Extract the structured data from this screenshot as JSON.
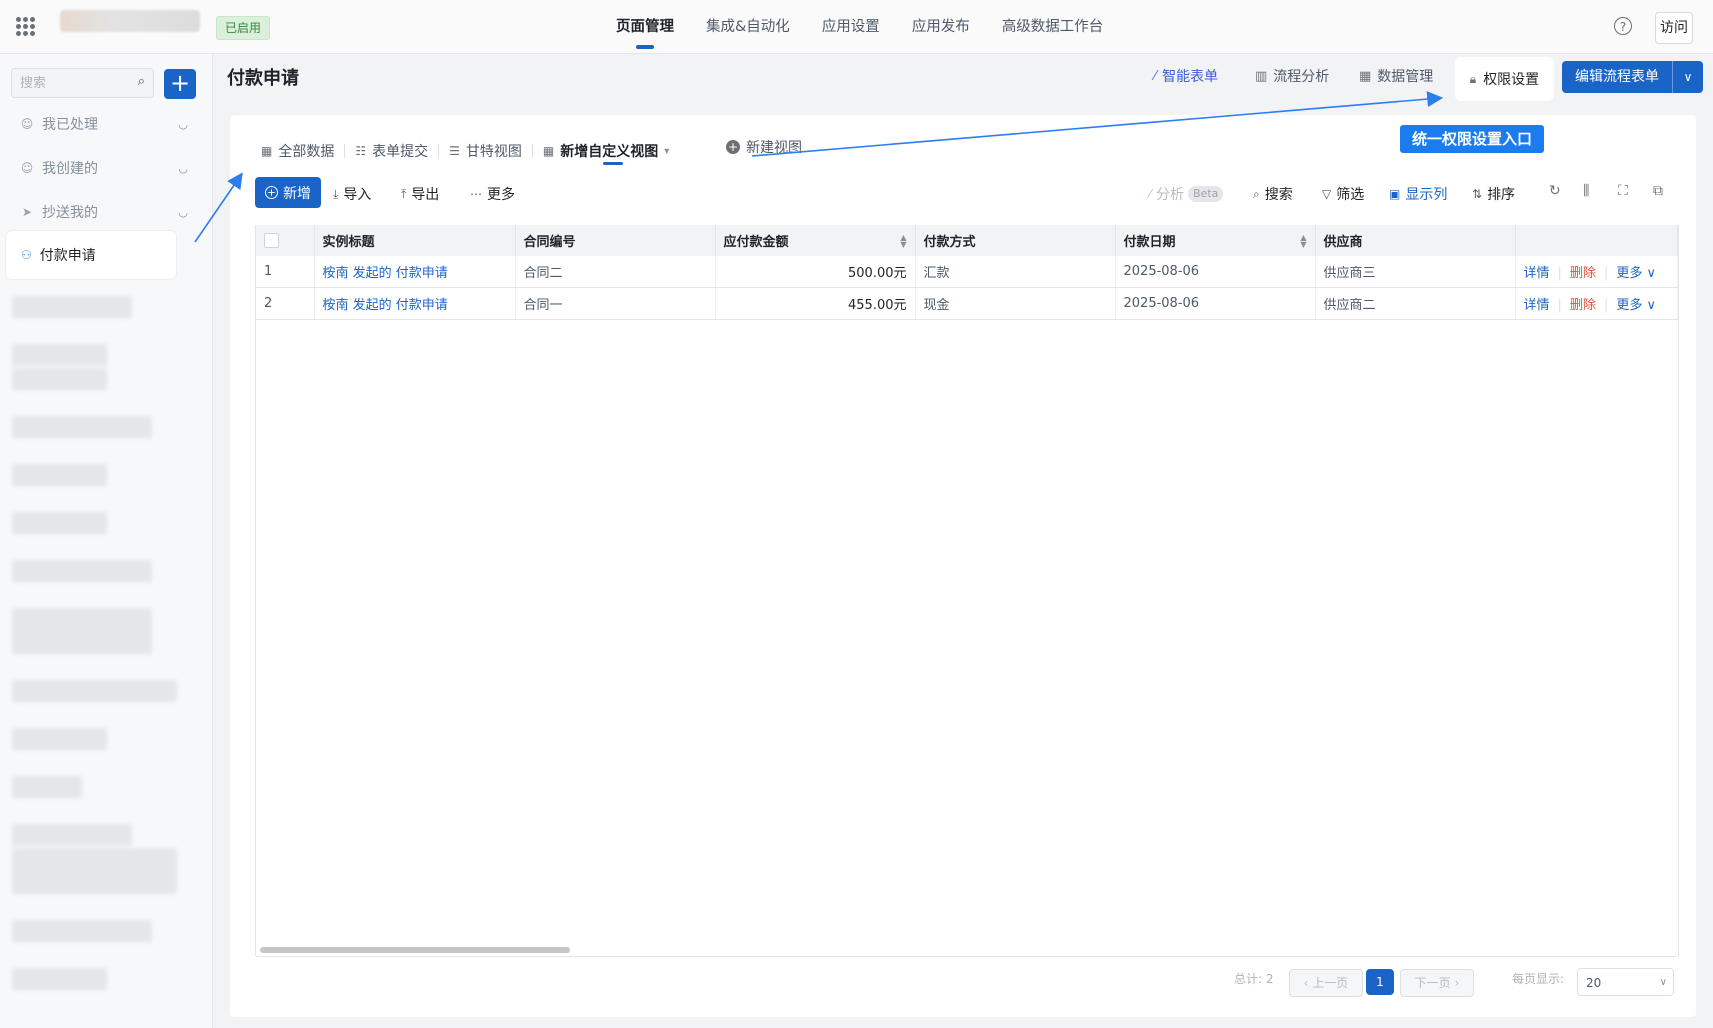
{
  "topbar": {
    "status": "已启用",
    "nav": [
      "页面管理",
      "集成&自动化",
      "应用设置",
      "应用发布",
      "高级数据工作台"
    ],
    "help": "?",
    "visit": "访问"
  },
  "sidebar": {
    "search_placeholder": "搜索",
    "add": "+",
    "items": [
      {
        "label": "我已处理",
        "icon": "user-check-icon"
      },
      {
        "label": "我创建的",
        "icon": "user-icon"
      },
      {
        "label": "抄送我的",
        "icon": "send-icon"
      }
    ],
    "active": "付款申请"
  },
  "header": {
    "title": "付款申请",
    "ai_form": "智能表单",
    "flow_analysis": "流程分析",
    "data_manage": "数据管理",
    "permission": "权限设置",
    "edit_form": "编辑流程表单"
  },
  "views": {
    "tabs": [
      "全部数据",
      "表单提交",
      "甘特视图",
      "新增自定义视图"
    ],
    "new_view": "新建视图"
  },
  "annotation": "统一权限设置入口",
  "toolbar": {
    "new": "新增",
    "import": "导入",
    "export": "导出",
    "more": "更多",
    "analyze": "分析",
    "beta": "Beta",
    "search": "搜索",
    "filter": "筛选",
    "columns": "显示列",
    "sort": "排序"
  },
  "table": {
    "headers": [
      "实例标题",
      "合同编号",
      "应付款金额",
      "付款方式",
      "付款日期",
      "供应商"
    ],
    "rows": [
      {
        "idx": "1",
        "title": "桉南 发起的 付款申请",
        "contract": "合同二",
        "amount": "500.00元",
        "method": "汇款",
        "date": "2025-08-06",
        "supplier": "供应商三"
      },
      {
        "idx": "2",
        "title": "桉南 发起的 付款申请",
        "contract": "合同一",
        "amount": "455.00元",
        "method": "现金",
        "date": "2025-08-06",
        "supplier": "供应商二"
      }
    ],
    "actions": {
      "detail": "详情",
      "delete": "删除",
      "more": "更多"
    }
  },
  "pagination": {
    "total": "总计: 2",
    "prev": "上一页",
    "current": "1",
    "next": "下一页",
    "page_size_label": "每页显示:",
    "page_size": "20"
  },
  "colors": {
    "accent": "#1b64c7",
    "callout": "#1b7cf0",
    "danger": "#e0503c"
  }
}
